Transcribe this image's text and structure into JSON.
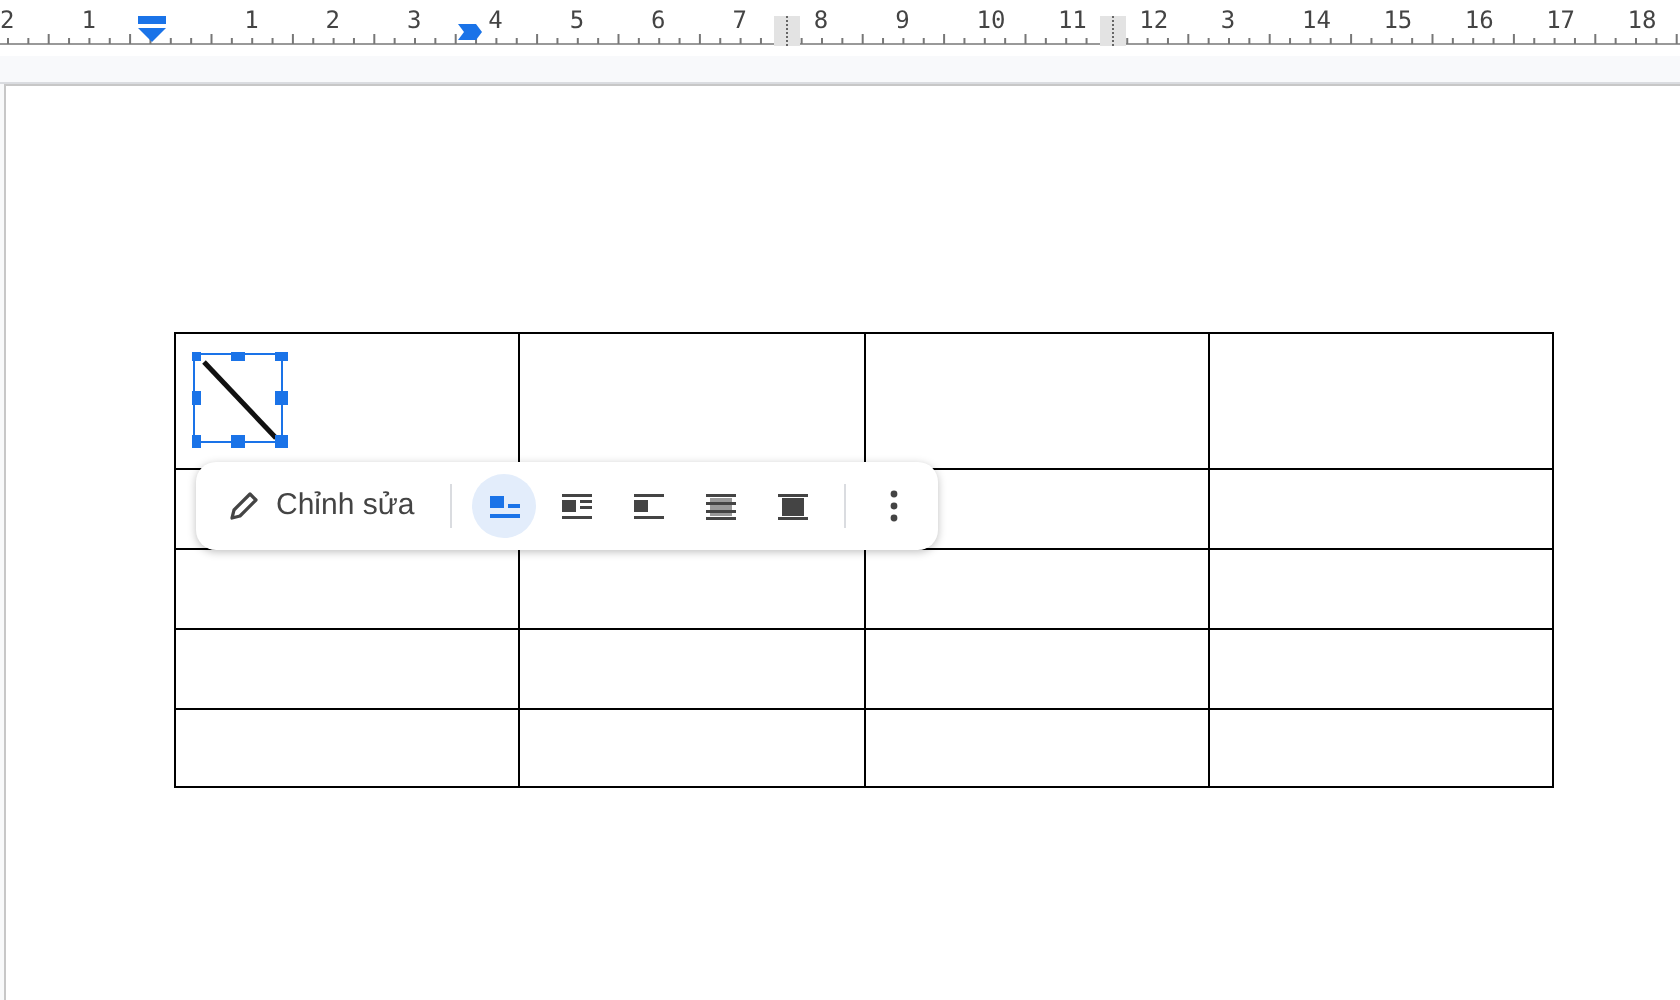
{
  "ruler": {
    "items": [
      {
        "kind": "number",
        "label": "2"
      },
      {
        "kind": "number",
        "label": "1"
      },
      {
        "kind": "indent"
      },
      {
        "kind": "number",
        "label": "1"
      },
      {
        "kind": "number",
        "label": "2"
      },
      {
        "kind": "number",
        "label": "3"
      },
      {
        "kind": "number",
        "label": "4",
        "tab_stop": true
      },
      {
        "kind": "number",
        "label": "5"
      },
      {
        "kind": "number",
        "label": "6"
      },
      {
        "kind": "number",
        "label": "7"
      },
      {
        "kind": "number",
        "label": "8",
        "column_marker": true
      },
      {
        "kind": "number",
        "label": "9"
      },
      {
        "kind": "number",
        "label": "10"
      },
      {
        "kind": "number",
        "label": "11"
      },
      {
        "kind": "number",
        "label": "12",
        "column_marker": true
      },
      {
        "kind": "number",
        "label": "3"
      },
      {
        "kind": "number",
        "label": "14"
      },
      {
        "kind": "number",
        "label": "15"
      },
      {
        "kind": "number",
        "label": "16"
      },
      {
        "kind": "number",
        "label": "17"
      },
      {
        "kind": "number",
        "label": "18"
      }
    ]
  },
  "table": {
    "rows": [
      {
        "cells": [
          {
            "kind": "image",
            "selected": true
          },
          {
            "kind": "empty"
          },
          {
            "kind": "empty"
          },
          {
            "kind": "empty"
          }
        ]
      },
      {
        "cells": [
          {
            "kind": "empty"
          },
          {
            "kind": "empty"
          },
          {
            "kind": "empty"
          },
          {
            "kind": "empty"
          }
        ]
      },
      {
        "cells": [
          {
            "kind": "empty"
          },
          {
            "kind": "empty"
          },
          {
            "kind": "empty"
          },
          {
            "kind": "empty"
          }
        ]
      },
      {
        "cells": [
          {
            "kind": "empty"
          },
          {
            "kind": "empty"
          },
          {
            "kind": "empty"
          },
          {
            "kind": "empty"
          }
        ]
      },
      {
        "cells": [
          {
            "kind": "empty"
          },
          {
            "kind": "empty"
          },
          {
            "kind": "empty"
          },
          {
            "kind": "empty"
          }
        ]
      }
    ]
  },
  "toolbar": {
    "edit_button": {
      "label": "Chỉnh sửa"
    },
    "wrap_options": [
      {
        "kind": "inline",
        "selected": true
      },
      {
        "kind": "wrap",
        "selected": false
      },
      {
        "kind": "break",
        "selected": false
      },
      {
        "kind": "behind",
        "selected": false
      },
      {
        "kind": "front",
        "selected": false
      }
    ]
  }
}
